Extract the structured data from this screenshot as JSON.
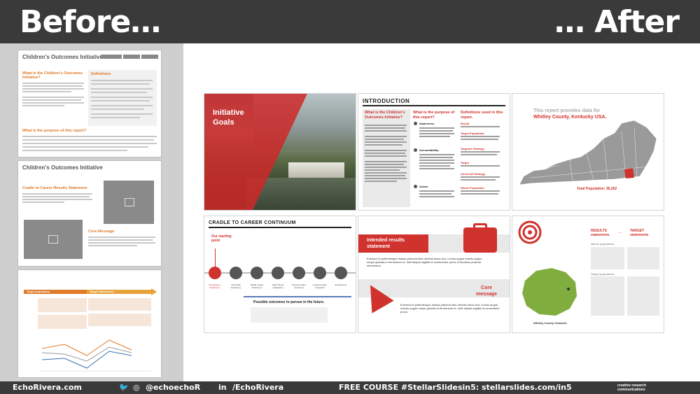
{
  "header": {
    "before_label": "Before…",
    "after_label": "… After"
  },
  "before": {
    "slide1": {
      "title": "Children's Outcomes Initiative",
      "heading_purpose": "What is the Children's Outcomes Initiative?",
      "heading_definitions": "Definitions",
      "heading_report": "What is the purpose of this report?"
    },
    "slide2": {
      "title": "Children's Outcomes Initiative",
      "heading_cradle": "Cradle to Career Results Statement",
      "heading_core": "Core Message"
    },
    "slide3": {
      "bar_left": "Target population",
      "bar_right": "Target Statements"
    }
  },
  "after": {
    "slide1": {
      "title": "Initiative Goals"
    },
    "slide2": {
      "heading": "INTRODUCTION",
      "col1": "What is the Children's Outcomes Initiative?",
      "col2": "What is the purpose of this report?",
      "col3": "Definitions used in this report.",
      "defs": [
        "Result",
        "Target Population",
        "Targeted Strategy",
        "Target",
        "Universal Strategy",
        "Whole Population"
      ],
      "items": [
        "Awareness",
        "Accountability",
        "Action"
      ]
    },
    "slide3": {
      "title_prefix": "This report provides data for",
      "title_place": "Whitley County, Kentucky USA.",
      "population_label": "Total Population: 36,262"
    },
    "slide4": {
      "heading": "CRADLE TO CAREER CONTINUUM",
      "starting": "Our starting point",
      "stages": [
        "Kindergarten Readiness",
        "3rd Grade Proficiency",
        "Middle Grade Proficiency",
        "High School Graduation",
        "Postsecondary enrollment",
        "Postsecondary completion",
        "Employment"
      ],
      "bottom_caption": "Possible outcomes to pursue in the future."
    },
    "slide5": {
      "heading1": "Intended results statement",
      "heading2": "Core message",
      "body1": "Euismod in pellentesque massa placerat duis ultricies lacus sed. Lectus augue mauris augue neque gravida in fermentum et. Velit aliquet sagittis id consectetur purus ut faucibus pulvinar elementum.",
      "body2": "Euismod in pellentesque massa placerat duis ultricies lacus sed. Lectus augue mauris augue neque gravida in fermentum et. Velit aliquet sagittis id consectetur purus."
    },
    "slide6": {
      "results": "RESULTS statements",
      "target": "TARGET statements",
      "whole": "Whole population",
      "target_pop": "Target population",
      "outskirts": "Whitley County Outskirts"
    }
  },
  "footer": {
    "site": "EchoRivera.com",
    "social": "@echoechoR",
    "linkedin": "/EchoRivera",
    "course": "FREE COURSE #StellarSlidesin5: stellarslides.com/in5",
    "logo": "creative research communications"
  },
  "colors": {
    "accent_red": "#d0322d",
    "accent_orange": "#e07b29",
    "bar_dark": "#3a3a3a"
  }
}
